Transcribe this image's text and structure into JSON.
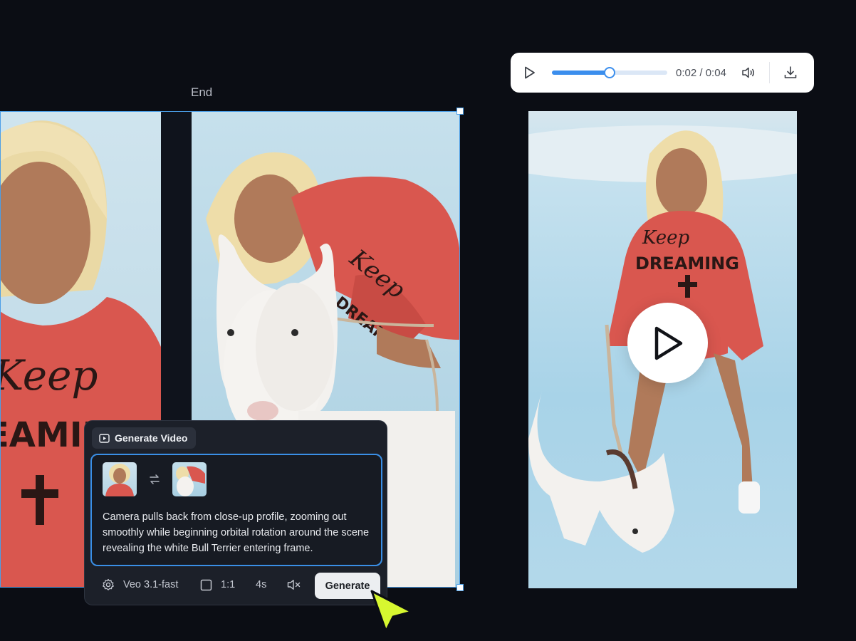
{
  "canvas": {
    "end_label": "End"
  },
  "player": {
    "time": "0:02 / 0:04",
    "progress": 0.5
  },
  "generate_panel": {
    "tab_label": "Generate Video",
    "prompt": "Camera pulls back from close-up profile, zooming out smoothly while beginning orbital rotation around the scene revealing the white Bull Terrier entering frame.",
    "model": "Veo 3.1-fast",
    "aspect_ratio": "1:1",
    "duration": "4s",
    "generate_label": "Generate"
  },
  "icons": [
    "play-icon",
    "volume-icon",
    "download-icon",
    "video-icon",
    "swap-icon",
    "settings-icon",
    "aspect-ratio-icon",
    "mute-icon",
    "pointer-cursor-icon"
  ],
  "colors": {
    "accent": "#3b8eed",
    "background": "#0b0d14",
    "panel": "#1c2029",
    "cursor": "#d7f730",
    "hoodie": "#d9574f"
  }
}
